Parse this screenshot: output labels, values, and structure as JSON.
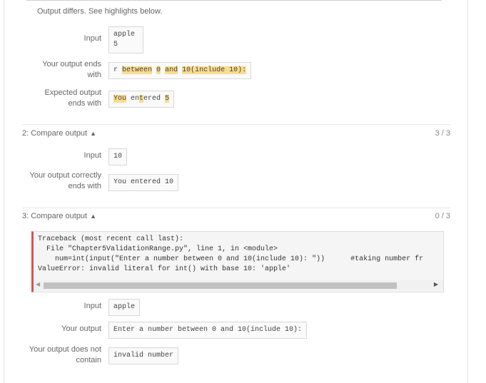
{
  "top_message": "Output differs. See highlights below.",
  "test1": {
    "input_label": "Input",
    "input_lines": [
      "apple",
      "5"
    ],
    "yours_label_line1": "Your output ends",
    "yours_label_line2": "with",
    "yours_parts": [
      {
        "t": "r ",
        "h": false
      },
      {
        "t": "between",
        "h": true
      },
      {
        "t": " ",
        "h": false
      },
      {
        "t": "0",
        "h": true
      },
      {
        "t": " ",
        "h": false
      },
      {
        "t": "and",
        "h": true
      },
      {
        "t": " ",
        "h": false
      },
      {
        "t": "10(include 10):",
        "h": true
      }
    ],
    "expected_label_line1": "Expected output",
    "expected_label_line2": "ends with",
    "expected_parts": [
      {
        "t": "You",
        "h": true
      },
      {
        "t": " en",
        "h": false
      },
      {
        "t": "t",
        "h": true
      },
      {
        "t": "ered ",
        "h": false
      },
      {
        "t": "5",
        "h": true
      }
    ]
  },
  "section2": {
    "title": "2: Compare output",
    "score": "3 / 3",
    "input_label": "Input",
    "input_value": "10",
    "yours_label_line1": "Your output correctly",
    "yours_label_line2": "ends with",
    "yours_value": "You entered 10"
  },
  "section3": {
    "title": "3: Compare output",
    "score": "0 / 3",
    "traceback": [
      "Traceback (most recent call last):",
      "  File \"Chapter5ValidationRange.py\", line 1, in <module>",
      "    num=int(input(\"Enter a number between 0 and 10(include 10): \"))      #taking number fr",
      "ValueError: invalid literal for int() with base 10: 'apple'"
    ],
    "input_label": "Input",
    "input_value": "apple",
    "yours_label": "Your output",
    "yours_value": "Enter a number between 0 and 10(include 10):",
    "notcontain_label_line1": "Your output does not",
    "notcontain_label_line2": "contain",
    "notcontain_value": "invalid number"
  },
  "icons": {
    "chevron": "chevron-up-icon",
    "scroll_left": "scroll-left-arrow-icon",
    "scroll_right": "scroll-right-arrow-icon"
  }
}
